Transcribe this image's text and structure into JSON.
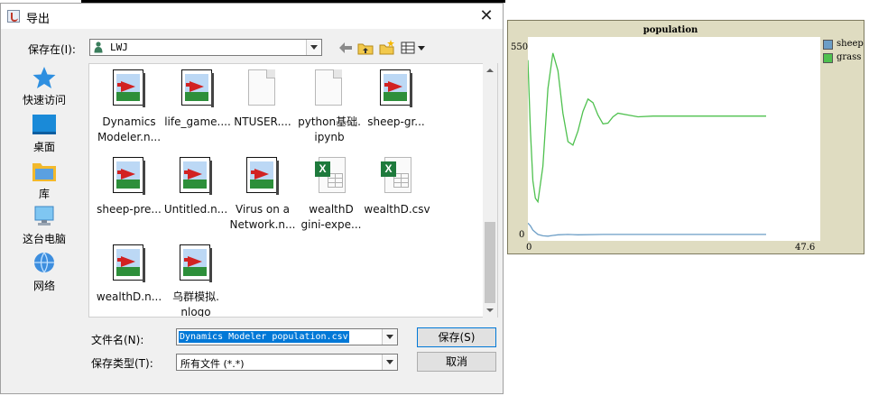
{
  "dialog": {
    "title": "导出",
    "close_glyph": "✕",
    "look_in_label": "保存在(I):",
    "look_in_value": "LWJ",
    "filename_label": "文件名(N):",
    "filename_value": "Dynamics Modeler population.csv",
    "filetype_label": "保存类型(T):",
    "filetype_value": "所有文件 (*.*)",
    "save_label": "保存(S)",
    "cancel_label": "取消"
  },
  "nav": [
    {
      "label": "快速访问",
      "icon": "star-icon"
    },
    {
      "label": "桌面",
      "icon": "desktop-icon"
    },
    {
      "label": "库",
      "icon": "library-icon"
    },
    {
      "label": "这台电脑",
      "icon": "computer-icon"
    },
    {
      "label": "网络",
      "icon": "network-icon"
    }
  ],
  "files": [
    {
      "name": "Dynamics\nModeler.n...",
      "type": "netlogo"
    },
    {
      "name": "life_game....",
      "type": "netlogo"
    },
    {
      "name": "NTUSER....",
      "type": "blank"
    },
    {
      "name": "python基础.\nipynb",
      "type": "blank"
    },
    {
      "name": "sheep-gr...",
      "type": "netlogo"
    },
    {
      "name": "sheep-pre...",
      "type": "netlogo"
    },
    {
      "name": "Untitled.n...",
      "type": "netlogo"
    },
    {
      "name": "Virus on a\nNetwork.n...",
      "type": "netlogo"
    },
    {
      "name": "wealthD\ngini-expe...",
      "type": "excel"
    },
    {
      "name": "wealthD.csv",
      "type": "excel"
    },
    {
      "name": "wealthD.n...",
      "type": "netlogo"
    },
    {
      "name": "乌群模拟.\nnlogo",
      "type": "netlogo"
    }
  ],
  "plot": {
    "y_max_label": "550",
    "y_min_label": "0",
    "x_min_label": "0",
    "x_max_label": "47.6"
  },
  "chart_data": {
    "type": "line",
    "title": "population",
    "xlabel": "",
    "ylabel": "",
    "xlim": [
      0,
      47.6
    ],
    "ylim": [
      0,
      550
    ],
    "legend_position": "right",
    "series": [
      {
        "name": "sheep",
        "color": "#6c9ec6",
        "x": [
          0,
          0.5,
          1,
          2,
          3,
          4,
          5,
          6,
          8,
          10,
          15,
          20,
          30,
          40,
          47.6
        ],
        "y": [
          40,
          32,
          20,
          8,
          4,
          3,
          5,
          7,
          8,
          7,
          8,
          8,
          8,
          8,
          8
        ]
      },
      {
        "name": "grass",
        "color": "#4fc14f",
        "x": [
          0,
          0.5,
          1,
          1.5,
          2,
          3,
          4,
          5,
          6,
          7,
          8,
          9,
          10,
          11,
          12,
          13,
          14,
          15,
          16,
          17,
          18,
          20,
          22,
          25,
          30,
          35,
          40,
          47.6
        ],
        "y": [
          500,
          300,
          160,
          110,
          100,
          200,
          420,
          520,
          470,
          350,
          270,
          260,
          300,
          355,
          390,
          380,
          345,
          320,
          322,
          340,
          350,
          345,
          340,
          342,
          342,
          342,
          342,
          342
        ]
      }
    ]
  }
}
